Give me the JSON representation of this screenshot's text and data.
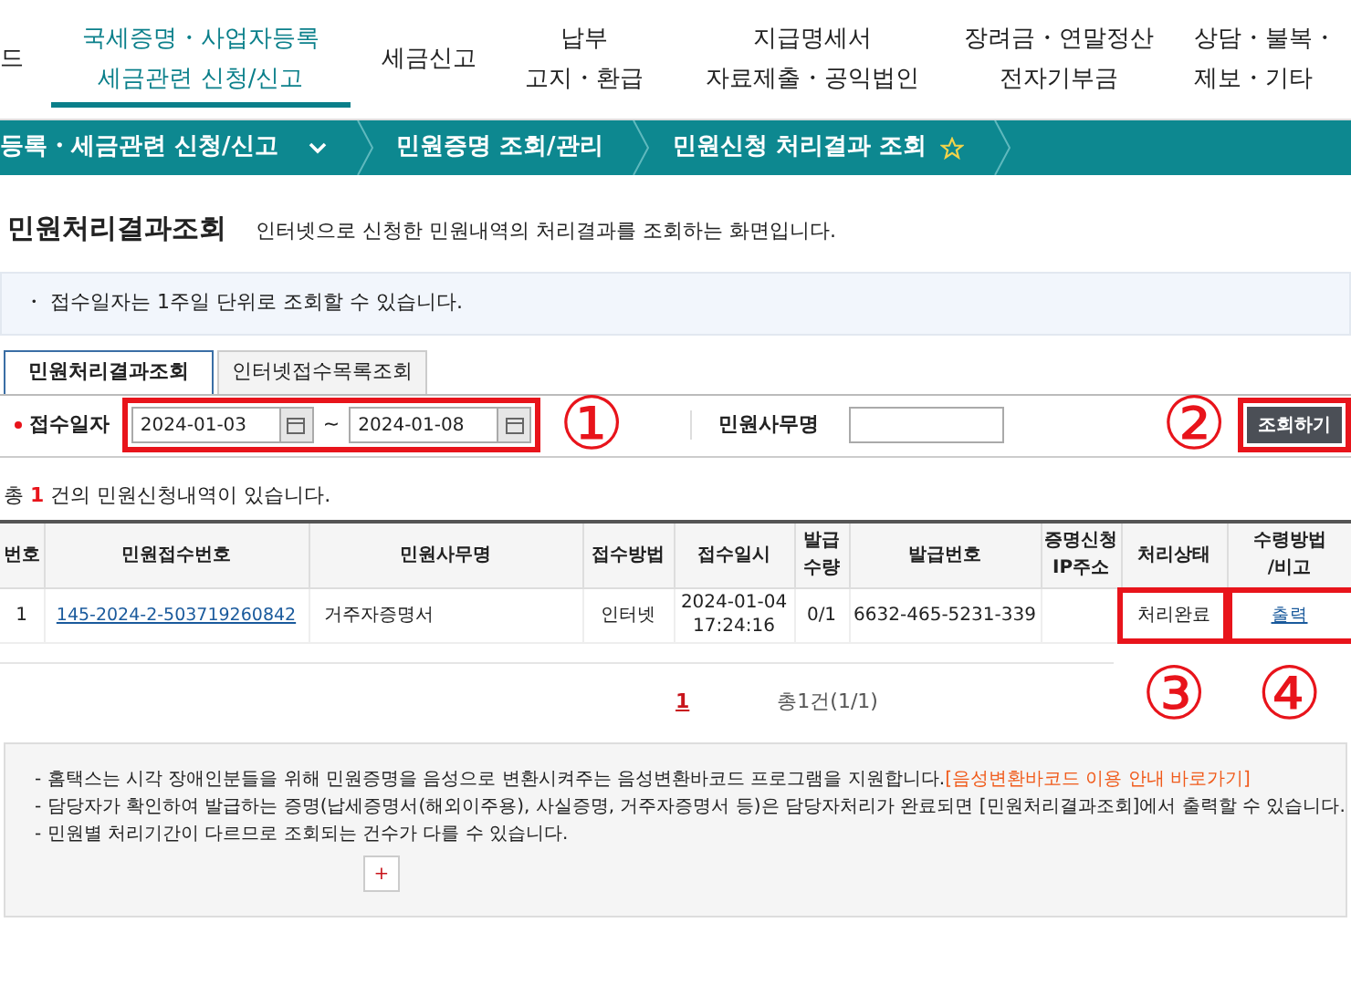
{
  "top_nav": [
    {
      "lines": [
        "드"
      ],
      "selected": false
    },
    {
      "lines": [
        "국세증명・사업자등록",
        "세금관련 신청/신고"
      ],
      "selected": true
    },
    {
      "lines": [
        "세금신고"
      ],
      "selected": false
    },
    {
      "lines": [
        "납부",
        "고지・환급"
      ],
      "selected": false
    },
    {
      "lines": [
        "지급명세서",
        "자료제출・공익법인"
      ],
      "selected": false
    },
    {
      "lines": [
        "장려금・연말정산",
        "전자기부금"
      ],
      "selected": false
    },
    {
      "lines": [
        "상담・불복・",
        "제보・기타"
      ],
      "selected": false
    }
  ],
  "breadcrumb": [
    "등록・세금관련 신청/신고",
    "민원증명 조회/관리",
    "민원신청 처리결과 조회"
  ],
  "page_title": "민원처리결과조회",
  "page_description": "인터넷으로 신청한 민원내역의 처리결과를 조회하는 화면입니다.",
  "info_note": "・ 접수일자는 1주일 단위로 조회할 수 있습니다.",
  "tabs": [
    {
      "label": "민원처리결과조회",
      "selected": true
    },
    {
      "label": "인터넷접수목록조회",
      "selected": false
    }
  ],
  "search": {
    "date_label": "접수일자",
    "date_from": "2024-01-03",
    "date_separator": "~",
    "date_to": "2024-01-08",
    "date_highlighted": true,
    "date_callout": "①",
    "name_label": "민원사무명",
    "search_button": "조회하기",
    "button_highlighted": true,
    "button_callout": "②"
  },
  "result_count": {
    "prefix": "총 ",
    "count": "1",
    "suffix": " 건의 민원신청내역이 있습니다."
  },
  "table": {
    "columns": [
      {
        "lines": [
          "번호"
        ]
      },
      {
        "lines": [
          "민원접수번호"
        ]
      },
      {
        "lines": [
          "민원사무명"
        ]
      },
      {
        "lines": [
          "접수방법"
        ]
      },
      {
        "lines": [
          "접수일시"
        ]
      },
      {
        "lines": [
          "발급",
          "수량"
        ]
      },
      {
        "lines": [
          "발급번호"
        ]
      },
      {
        "lines": [
          "증명신청",
          "IP주소"
        ]
      },
      {
        "lines": [
          "처리상태"
        ]
      },
      {
        "lines": [
          "수령방법",
          "/비고"
        ]
      }
    ],
    "rows": [
      {
        "cells": [
          {
            "kind": "text",
            "lines": [
              "1"
            ]
          },
          {
            "kind": "link",
            "lines": [
              "145-2024-2-503719260842"
            ]
          },
          {
            "kind": "text",
            "lines": [
              "거주자증명서"
            ]
          },
          {
            "kind": "text",
            "lines": [
              "인터넷"
            ]
          },
          {
            "kind": "text",
            "lines": [
              "2024-01-04",
              "17:24:16"
            ]
          },
          {
            "kind": "text",
            "lines": [
              "0/1"
            ]
          },
          {
            "kind": "text",
            "lines": [
              "6632-465-5231-339"
            ]
          },
          {
            "kind": "empty"
          },
          {
            "kind": "text",
            "lines": [
              "처리완료"
            ],
            "highlighted": true,
            "callout": "③"
          },
          {
            "kind": "link",
            "lines": [
              "출력"
            ],
            "highlighted": true,
            "callout": "④"
          }
        ]
      }
    ]
  },
  "pagination": {
    "pages": [
      {
        "label": "1",
        "selected": true
      }
    ],
    "summary": "총1건(1/1)"
  },
  "notes": [
    {
      "text": "- 홈택스는 시각 장애인분들을 위해 민원증명을 음성으로 변환시켜주는 음성변환바코드 프로그램을 지원합니다.",
      "link": "[음성변환바코드 이용 안내 바로가기]"
    },
    {
      "text": "- 담당자가 확인하여 발급하는 증명(납세증명서(해외이주용), 사실증명, 거주자증명서 등)은 담당자처리가 완료되면 [민원처리결과조회]에서 출력할 수 있습니다."
    },
    {
      "text": "- 민원별 처리기간이 다르므로 조회되는 건수가 다를 수 있습니다."
    }
  ],
  "more_button": "+"
}
